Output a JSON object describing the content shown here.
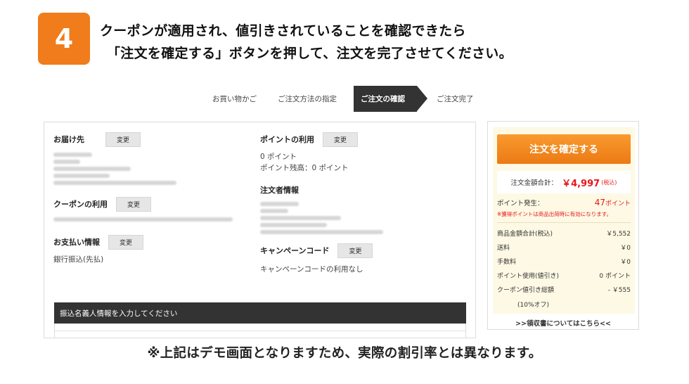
{
  "step_badge": "4",
  "instruction": {
    "line1": "クーポンが適用され、値引きされていることを確認できたら",
    "line2": "「注文を確定する」ボタンを押して、注文を完了させてください。"
  },
  "progress_steps": {
    "cart": "お買い物かご",
    "method": "ご注文方法の指定",
    "confirm": "ご注文の確認",
    "complete": "ご注文完了"
  },
  "left_col": {
    "shipping_title": "お届け先",
    "coupon_title": "クーポンの利用",
    "payment_title": "お支払い情報",
    "payment_value": "銀行振込(先払)"
  },
  "right_col": {
    "points_title": "ポイントの利用",
    "points_value": "0 ポイント",
    "points_balance": "ポイント残高：0 ポイント",
    "orderer_title": "注文者情報",
    "campaign_title": "キャンペーンコード",
    "campaign_value": "キャンペーンコードの利用なし"
  },
  "change_label": "変更",
  "transfer_bar": "振込名義人情報を入力してください",
  "summary": {
    "confirm_button": "注文を確定する",
    "total_label": "注文金額合計：",
    "total_value": "￥4,997",
    "tax_note": "(税込)",
    "points_label": "ポイント発生：",
    "points_value": "47",
    "points_unit": "ポイント",
    "points_note": "※獲得ポイントは商品出荷時に有効になります。",
    "rows": [
      {
        "label": "商品金額合計(税込)",
        "value": "￥5,552"
      },
      {
        "label": "送料",
        "value": "￥0"
      },
      {
        "label": "手数料",
        "value": "￥0"
      },
      {
        "label": "ポイント使用(値引き)",
        "value": "0 ポイント"
      },
      {
        "label": "クーポン値引き総額",
        "value": "- ￥555"
      }
    ],
    "coupon_rate": "(10%オフ)",
    "receipt_link": ">>領収書についてはこちら<<"
  },
  "colors": {
    "accent_orange": "#f07c1c",
    "price_red": "#e8161b",
    "summary_bg": "#fdf9e4"
  },
  "footnote": "※上記はデモ画面となりますため、実際の割引率とは異なります。"
}
